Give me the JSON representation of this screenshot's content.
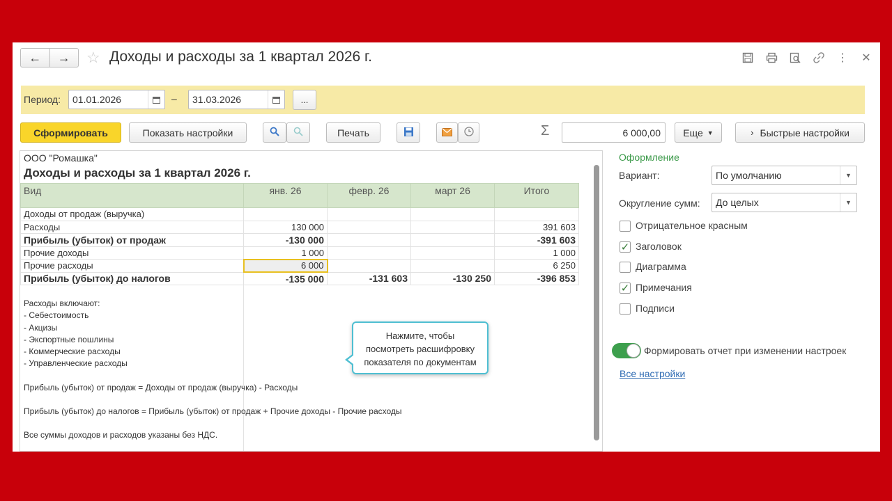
{
  "window": {
    "title": "Доходы и расходы за 1 квартал 2026 г.",
    "nav": {
      "back_glyph": "←",
      "forward_glyph": "→"
    },
    "icons": [
      "save-icon",
      "print-icon",
      "preview-icon",
      "link-icon",
      "more-icon",
      "close-icon"
    ]
  },
  "period": {
    "label": "Период:",
    "from": "01.01.2026",
    "dash": "–",
    "to": "31.03.2026",
    "more": "..."
  },
  "toolbar": {
    "generate": "Сформировать",
    "show_settings": "Показать настройки",
    "print": "Печать",
    "sum_value": "6 000,00",
    "more": "Еще",
    "quick_settings": "Быстрые настройки"
  },
  "report": {
    "org": "ООО \"Ромашка\"",
    "title": "Доходы и расходы за 1 квартал 2026 г.",
    "columns": [
      "Вид",
      "янв. 26",
      "февр. 26",
      "март 26",
      "Итого"
    ],
    "rows": [
      {
        "label": "Доходы от продаж (выручка)",
        "values": [
          "",
          "",
          "",
          ""
        ],
        "bold": false
      },
      {
        "label": "Расходы",
        "values": [
          "130 000",
          "",
          "",
          "391 603"
        ],
        "bold": false
      },
      {
        "label": "Прибыль (убыток) от продаж",
        "values": [
          "-130 000",
          "",
          "",
          "-391 603"
        ],
        "bold": true
      },
      {
        "label": "Прочие доходы",
        "values": [
          "1 000",
          "",
          "",
          "1 000"
        ],
        "bold": false
      },
      {
        "label": "Прочие расходы",
        "values": [
          "6 000",
          "",
          "",
          "6 250"
        ],
        "bold": false
      },
      {
        "label": "Прибыль (убыток) до налогов",
        "values": [
          "-135 000",
          "-131 603",
          "-130 250",
          "-396 853"
        ],
        "bold": true
      }
    ],
    "notes": [
      "Расходы включают:",
      "- Себестоимость",
      "- Акцизы",
      "- Экспортные пошлины",
      "- Коммерческие расходы",
      "- Управленческие расходы",
      "",
      "Прибыль (убыток) от продаж = Доходы от продаж (выручка) - Расходы",
      "",
      "Прибыль (убыток) до налогов = Прибыль (убыток) от продаж + Прочие доходы - Прочие расходы",
      "",
      "Все суммы доходов и расходов указаны без НДС."
    ],
    "tooltip": {
      "line1": "Нажмите, чтобы",
      "line2": "посмотреть расшифровку",
      "line3": "показателя по документам"
    }
  },
  "settings": {
    "section": "Оформление",
    "variant_label": "Вариант:",
    "variant_value": "По умолчанию",
    "rounding_label": "Округление сумм:",
    "rounding_value": "До целых",
    "checkboxes": [
      {
        "label": "Отрицательное красным",
        "checked": false
      },
      {
        "label": "Заголовок",
        "checked": true
      },
      {
        "label": "Диаграмма",
        "checked": false
      },
      {
        "label": "Примечания",
        "checked": true
      },
      {
        "label": "Подписи",
        "checked": false
      }
    ],
    "auto_generate_label": "Формировать отчет при изменении настроек",
    "auto_generate_on": true,
    "all_settings_link": "Все настройки"
  }
}
